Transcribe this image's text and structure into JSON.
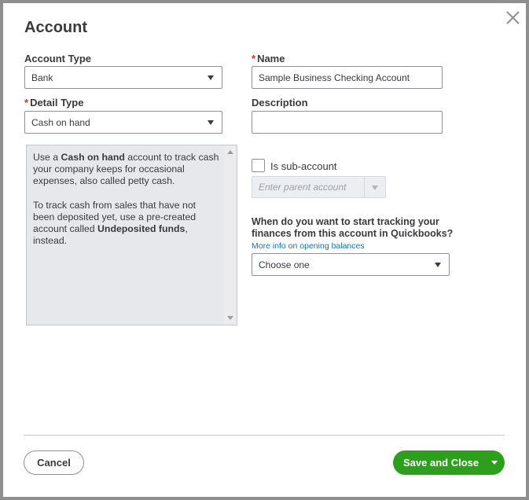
{
  "dialog": {
    "title": "Account",
    "close_icon": "close-x-icon"
  },
  "left": {
    "account_type_label": "Account Type",
    "account_type_value": "Bank",
    "detail_type_label": "Detail Type",
    "detail_type_value": "Cash on hand",
    "help": {
      "p1_pre": "Use a ",
      "p1_bold": "Cash on hand",
      "p1_post": " account to track cash your company keeps for occasional expenses, also called petty cash.",
      "p2_pre": "To track cash from sales that have not been deposited yet, use a pre-created account called ",
      "p2_bold": "Undeposited funds",
      "p2_post": ", instead."
    }
  },
  "right": {
    "name_label": "Name",
    "name_value": "Sample Business Checking Account",
    "description_label": "Description",
    "description_value": "",
    "subaccount_label": "Is sub-account",
    "subaccount_checked": false,
    "parent_placeholder": "Enter parent account",
    "question": "When do you want to start tracking your finances from this account in Quickbooks?",
    "link": "More info on opening balances",
    "start_select_value": "Choose one"
  },
  "required_mark": "*",
  "footer": {
    "cancel": "Cancel",
    "save_close": "Save and Close"
  },
  "colors": {
    "primary_green": "#2ca01c",
    "link_blue": "#0077c5",
    "required_red": "#d52b1e",
    "help_bg": "#e7e8ec"
  }
}
